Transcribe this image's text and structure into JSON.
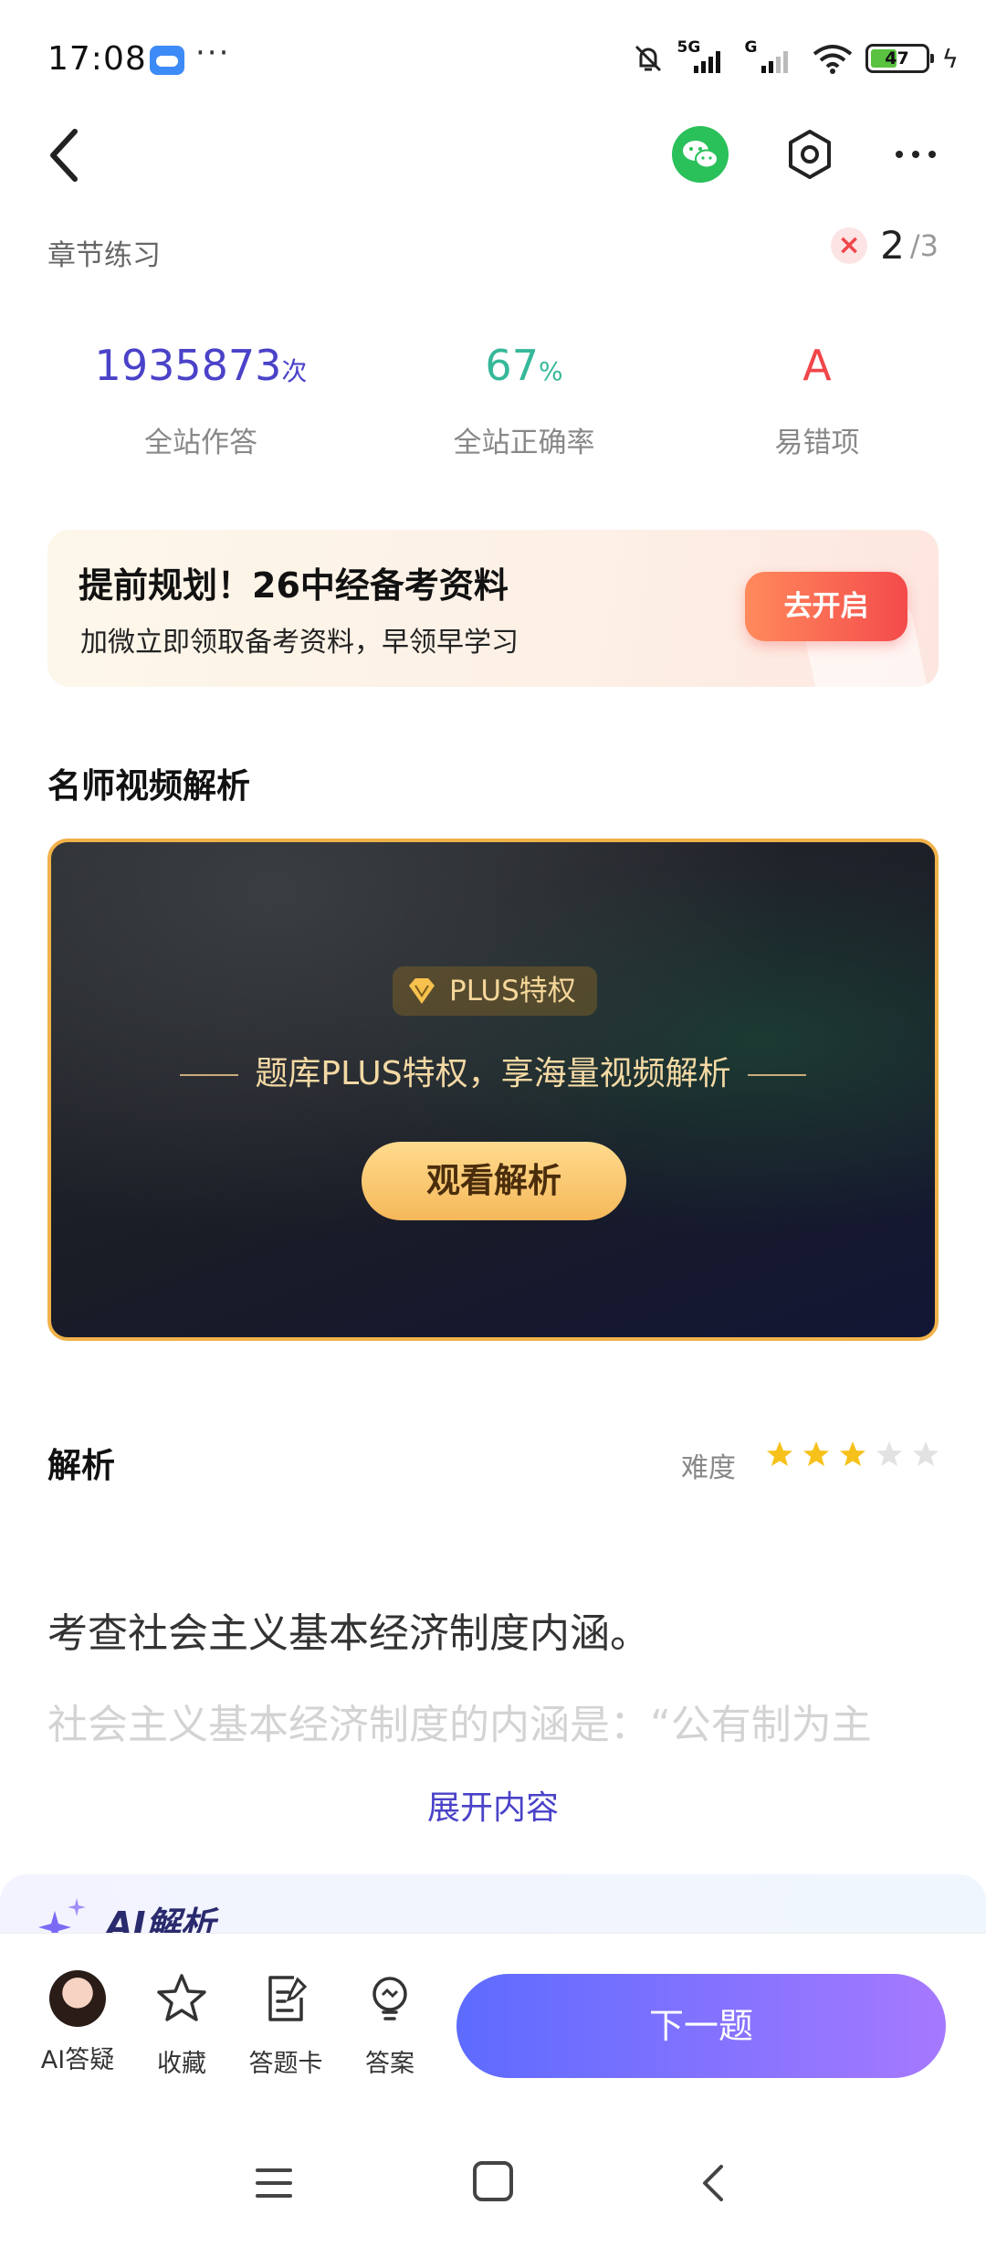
{
  "status_bar": {
    "time": "17:08",
    "more": "···",
    "signal_1": "5G",
    "signal_2": "G",
    "battery": "47",
    "icons": [
      "cloud-icon",
      "bell-off-icon",
      "wifi-icon",
      "battery-icon",
      "charging-icon"
    ]
  },
  "nav": {
    "icons": [
      "back-icon",
      "wechat-icon",
      "settings-icon",
      "more-icon"
    ]
  },
  "header": {
    "section": "章节练习",
    "progress_current": "2",
    "progress_total": "/3",
    "wrong_mark": "×"
  },
  "stats": [
    {
      "value": "1935873",
      "unit": "次",
      "label": "全站作答",
      "color": "#4a42c8"
    },
    {
      "value": "67",
      "unit": "%",
      "label": "全站正确率",
      "color": "#36b89a"
    },
    {
      "value": "A",
      "unit": "",
      "label": "易错项",
      "color": "#f0464a"
    }
  ],
  "promo": {
    "title": "提前规划！26中经备考资料",
    "subtitle": "加微立即领取备考资料，早领早学习",
    "button": "去开启"
  },
  "video": {
    "section_title": "名师视频解析",
    "badge": "PLUS特权",
    "tagline": "题库PLUS特权，享海量视频解析",
    "button": "观看解析"
  },
  "analysis": {
    "title": "解析",
    "difficulty_label": "难度",
    "difficulty_stars": 3,
    "difficulty_max": 5,
    "paragraph_1": "考查社会主义基本经济制度内涵。",
    "paragraph_2": "社会主义基本经济制度的内涵是：“公有制为主",
    "expand": "展开内容"
  },
  "ai_section": {
    "title": "AI解析"
  },
  "bottom_bar": {
    "tools": [
      {
        "label": "AI答疑",
        "icon": "ai-avatar-icon"
      },
      {
        "label": "收藏",
        "icon": "star-outline-icon"
      },
      {
        "label": "答题卡",
        "icon": "answer-sheet-icon"
      },
      {
        "label": "答案",
        "icon": "bulb-icon"
      }
    ],
    "next_button": "下一题"
  },
  "colors": {
    "accent": "#4a42c8",
    "next_gradient_start": "#5d6bff",
    "next_gradient_end": "#a679ff",
    "star_on": "#f7c11c",
    "star_off": "#e2e2e2"
  }
}
